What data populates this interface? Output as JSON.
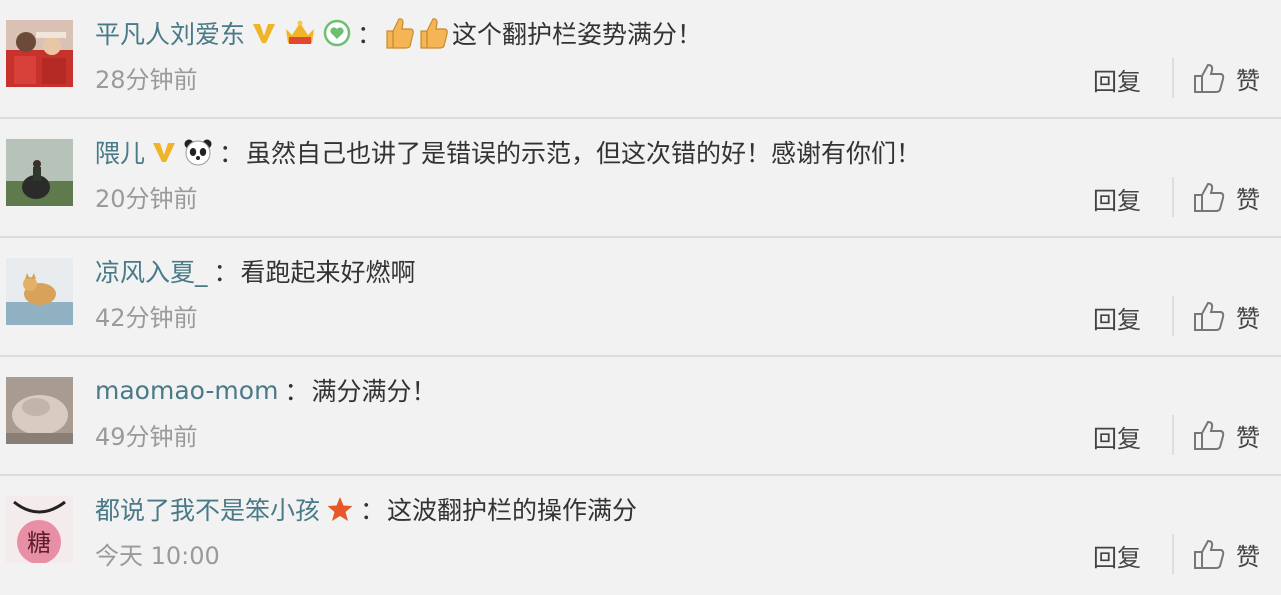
{
  "comments": [
    {
      "username": "平凡人刘爱东",
      "text": "这个翻护栏姿势满分！",
      "time": "28分钟前",
      "reply_label": "回复",
      "like_label": "赞"
    },
    {
      "username": "隈儿",
      "text": "虽然自己也讲了是错误的示范，但这次错的好！感谢有你们！",
      "time": "20分钟前",
      "reply_label": "回复",
      "like_label": "赞"
    },
    {
      "username": "凉风入夏_",
      "text": "看跑起来好燃啊",
      "time": "42分钟前",
      "reply_label": "回复",
      "like_label": "赞"
    },
    {
      "username": "maomao-mom",
      "text": "满分满分！",
      "time": "49分钟前",
      "reply_label": "回复",
      "like_label": "赞"
    },
    {
      "username": "都说了我不是笨小孩",
      "text": "这波翻护栏的操作满分",
      "time": "今天 10:00",
      "reply_label": "回复",
      "like_label": "赞"
    }
  ],
  "separator": "：",
  "avatar5_glyph": "糖",
  "colors": {
    "username": "#4a7a88",
    "text": "#333333",
    "time": "#9a9a9a",
    "verified_gold": "#f0b429",
    "star_orange": "#e8572a",
    "background": "#f2f2f2"
  }
}
